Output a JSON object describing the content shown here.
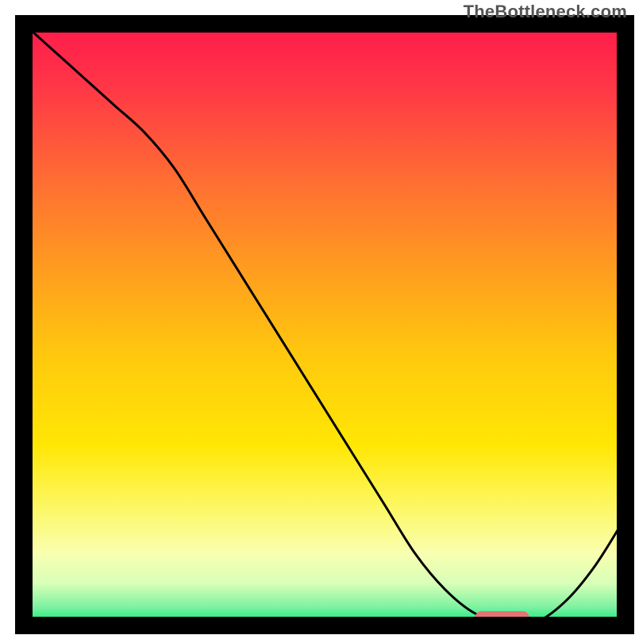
{
  "watermark": "TheBottleneck.com",
  "chart_data": {
    "type": "line",
    "title": "",
    "xlabel": "",
    "ylabel": "",
    "xlim": [
      0,
      100
    ],
    "ylim": [
      0,
      100
    ],
    "x": [
      0,
      5,
      10,
      15,
      20,
      25,
      30,
      35,
      40,
      45,
      50,
      55,
      60,
      65,
      70,
      75,
      80,
      85,
      90,
      95,
      100
    ],
    "values": [
      100,
      95.5,
      91,
      86.5,
      82,
      76,
      68,
      60,
      52,
      44,
      36,
      28,
      20,
      12,
      6,
      2,
      0.5,
      0.5,
      4,
      10,
      18
    ],
    "marker_range_x": [
      75,
      84
    ],
    "gradient_stops": [
      {
        "offset": 0.0,
        "color": "#ff1a4b"
      },
      {
        "offset": 0.1,
        "color": "#ff3547"
      },
      {
        "offset": 0.25,
        "color": "#ff6a34"
      },
      {
        "offset": 0.4,
        "color": "#ff9a20"
      },
      {
        "offset": 0.55,
        "color": "#ffc80e"
      },
      {
        "offset": 0.7,
        "color": "#ffe704"
      },
      {
        "offset": 0.8,
        "color": "#fdf760"
      },
      {
        "offset": 0.88,
        "color": "#f9ffb0"
      },
      {
        "offset": 0.93,
        "color": "#d8ffb8"
      },
      {
        "offset": 0.97,
        "color": "#7cf2a0"
      },
      {
        "offset": 1.0,
        "color": "#00e676"
      }
    ],
    "marker_color": "#e57373",
    "curve_color": "#000000",
    "border_color": "#000000"
  }
}
